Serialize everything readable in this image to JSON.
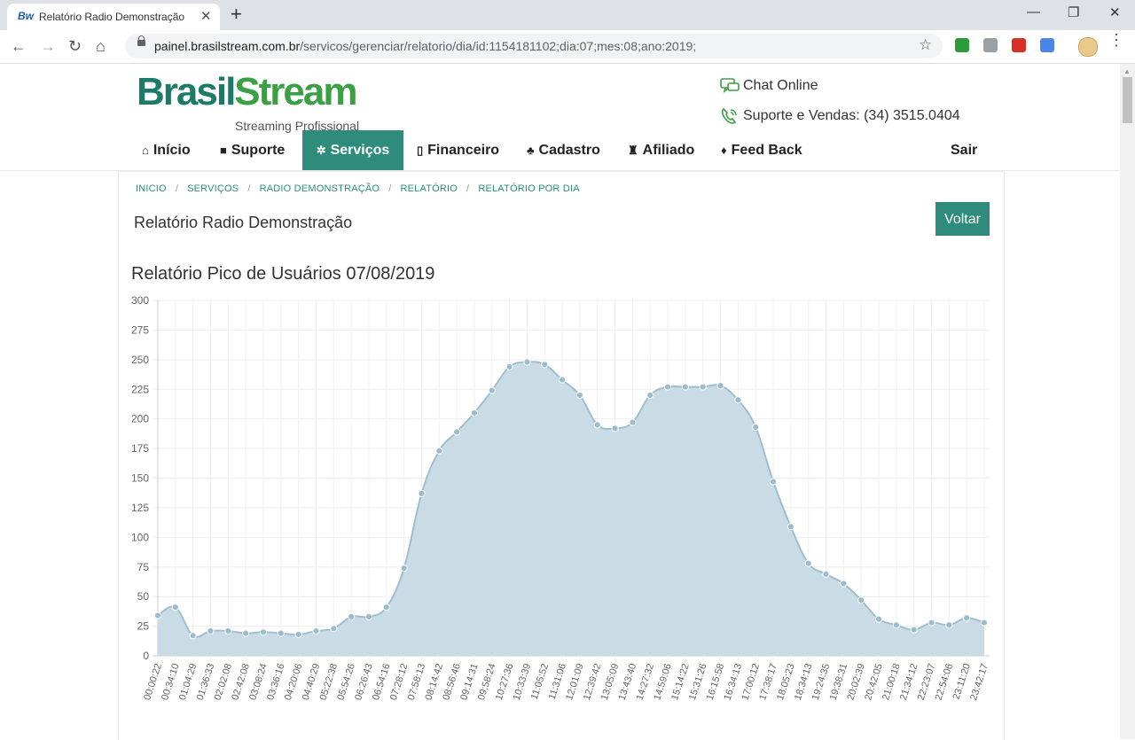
{
  "browser": {
    "tab_favicon": "Bw",
    "tab_title": "Relatório Radio Demonstração",
    "url_host": "painel.brasilstream.com.br",
    "url_path": "/servicos/gerenciar/relatorio/dia/id:1154181102;dia:07;mes:08;ano:2019;"
  },
  "header": {
    "logo_brasil": "Brasil",
    "logo_stream": "Stream",
    "logo_tagline": "Streaming Profissional",
    "chat_label": "Chat Online",
    "support_label": "Suporte e Vendas: (34) 3515.0404"
  },
  "nav": {
    "items": [
      {
        "label": "Início"
      },
      {
        "label": "Suporte"
      },
      {
        "label": "Serviços"
      },
      {
        "label": "Financeiro"
      },
      {
        "label": "Cadastro"
      },
      {
        "label": "Afiliado"
      },
      {
        "label": "Feed Back"
      }
    ],
    "logout": "Sair",
    "active_color": "#2f8c7c"
  },
  "breadcrumb": [
    "INICIO",
    "SERVIÇOS",
    "RADIO DEMONSTRAÇÃO",
    "RELATÓRIO",
    "RELATÓRIO POR DIA"
  ],
  "page": {
    "title": "Relatório Radio Demonstração",
    "back_button": "Voltar",
    "chart_title": "Relatório Pico de Usuários 07/08/2019"
  },
  "chart_data": {
    "type": "area",
    "title": "Relatório Pico de Usuários 07/08/2019",
    "xlabel": "",
    "ylabel": "",
    "ylim": [
      0,
      300
    ],
    "yticks": [
      0,
      25,
      50,
      75,
      100,
      125,
      150,
      175,
      200,
      225,
      250,
      275,
      300
    ],
    "grid": true,
    "fill_color": "#c6dae4",
    "line_color": "#9fbfcf",
    "x": [
      "00:00:22",
      "00:34:10",
      "01:04:29",
      "01:36:33",
      "02:02:08",
      "02:42:08",
      "03:08:24",
      "03:36:16",
      "04:20:06",
      "04:40:29",
      "05:22:38",
      "05:54:26",
      "06:26:43",
      "06:54:16",
      "07:28:12",
      "07:58:13",
      "08:14:42",
      "08:56:46",
      "09:14:31",
      "09:58:24",
      "10:27:36",
      "10:33:39",
      "11:05:52",
      "11:31:06",
      "12:01:09",
      "12:39:42",
      "13:05:09",
      "13:43:40",
      "14:27:32",
      "14:59:06",
      "15:14:22",
      "15:31:26",
      "16:15:58",
      "16:34:13",
      "17:00:12",
      "17:38:17",
      "18:05:23",
      "18:34:13",
      "19:24:35",
      "19:38:31",
      "20:02:39",
      "20:42:05",
      "21:00:18",
      "21:34:12",
      "22:23:07",
      "22:54:06",
      "23:11:20",
      "23:42:17"
    ],
    "values": [
      34,
      41,
      17,
      21,
      21,
      19,
      20,
      19,
      18,
      21,
      23,
      33,
      33,
      41,
      74,
      137,
      173,
      189,
      205,
      224,
      244,
      248,
      246,
      233,
      220,
      195,
      192,
      197,
      220,
      227,
      227,
      227,
      228,
      216,
      193,
      147,
      109,
      78,
      69,
      61,
      47,
      31,
      26,
      22,
      28,
      26,
      32,
      28
    ]
  }
}
